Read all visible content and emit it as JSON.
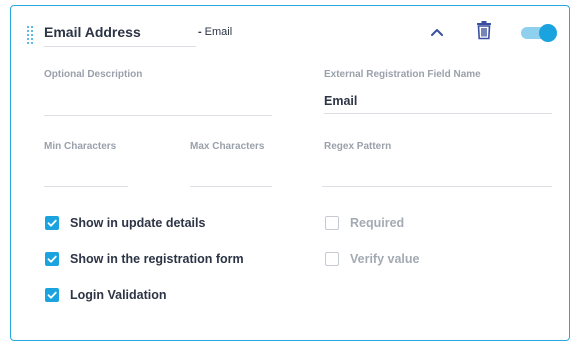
{
  "header": {
    "field_name": "Email Address",
    "type_separator": "-",
    "field_type": "Email",
    "enabled": true,
    "icons": [
      "drag-handle-icon",
      "chevron-up-icon",
      "trash-icon",
      "toggle-switch"
    ]
  },
  "fields": {
    "optional_description": {
      "label": "Optional Description",
      "value": ""
    },
    "external_name": {
      "label": "External Registration Field Name",
      "value": "Email"
    },
    "min_characters": {
      "label": "Min Characters",
      "value": ""
    },
    "max_characters": {
      "label": "Max Characters",
      "value": ""
    },
    "regex_pattern": {
      "label": "Regex Pattern",
      "value": ""
    }
  },
  "options": {
    "show_in_update_details": {
      "label": "Show in update details",
      "checked": true
    },
    "show_in_registration_form": {
      "label": "Show in the registration form",
      "checked": true
    },
    "login_validation": {
      "label": "Login Validation",
      "checked": true
    },
    "required": {
      "label": "Required",
      "checked": false
    },
    "verify_value": {
      "label": "Verify value",
      "checked": false
    }
  },
  "colors": {
    "accent": "#1aa3de",
    "border": "#29a8e0",
    "label_gray": "#9aa1ab",
    "text_dark": "#2c3445"
  }
}
